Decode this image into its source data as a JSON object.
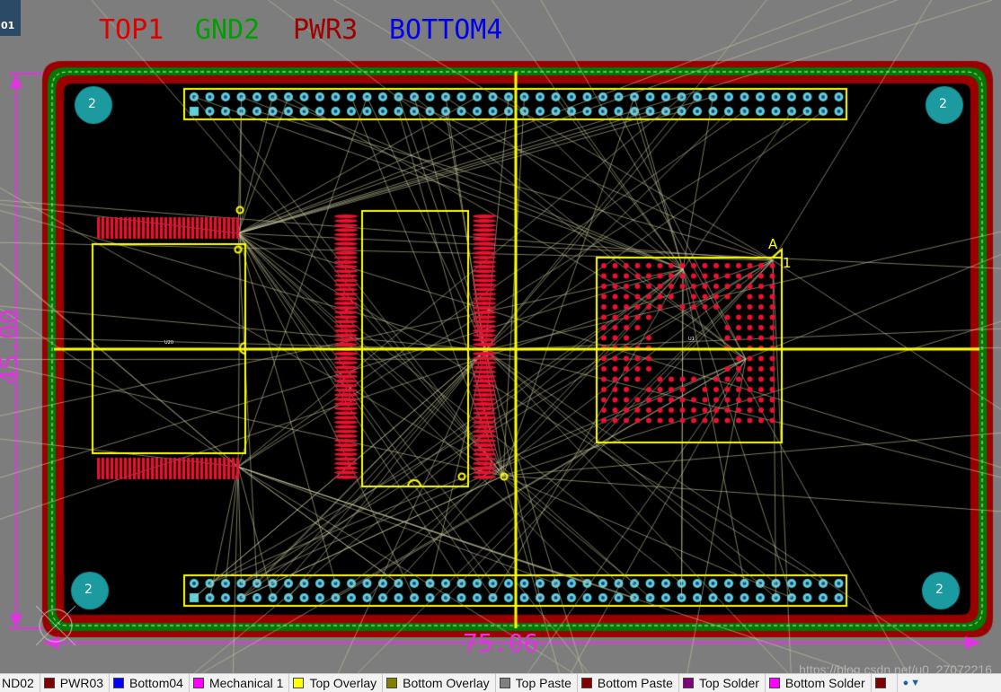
{
  "corner_tag": "01",
  "layer_titles": [
    {
      "name": "title-top1",
      "text": "TOP1",
      "color": "#e00000"
    },
    {
      "name": "title-gnd2",
      "text": "GND2",
      "color": "#00a000"
    },
    {
      "name": "title-pwr3",
      "text": "PWR3",
      "color": "#a00000"
    },
    {
      "name": "title-bottom4",
      "text": "BOTTOM4",
      "color": "#0000ee"
    }
  ],
  "dimensions": {
    "horizontal": "75.06",
    "vertical": "45.00",
    "color": "#e233e2"
  },
  "mounting_holes": [
    {
      "label": "2"
    },
    {
      "label": "2"
    },
    {
      "label": "2"
    },
    {
      "label": "2"
    }
  ],
  "components": {
    "u20_label": "U20",
    "u1_label": "U1",
    "u1_pin_a": "A",
    "u1_pin_1": "1"
  },
  "colors": {
    "board_black": "#000000",
    "board_outline_green": "#007a00",
    "board_outline_red": "#9a0000",
    "overlay_yellow": "#ffff00",
    "pad_red": "#ee1030",
    "mount_teal": "#1b9aa0",
    "ratsnest": "#c8c8a0",
    "header_pad": "#5fd0d8"
  },
  "layer_bar": {
    "tabs": [
      {
        "label": "ND02",
        "color": null
      },
      {
        "label": "PWR03",
        "color": "#800000"
      },
      {
        "label": "Bottom04",
        "color": "#0000ff"
      },
      {
        "label": "Mechanical 1",
        "color": "#ff00ff"
      },
      {
        "label": "Top Overlay",
        "color": "#ffff00"
      },
      {
        "label": "Bottom Overlay",
        "color": "#808000"
      },
      {
        "label": "Top Paste",
        "color": "#808080"
      },
      {
        "label": "Bottom Paste",
        "color": "#800000"
      },
      {
        "label": "Top Solder",
        "color": "#800080"
      },
      {
        "label": "Bottom Solder",
        "color": "#ff00ff"
      }
    ]
  },
  "watermark": "https://blog.csdn.net/u0_27072216"
}
